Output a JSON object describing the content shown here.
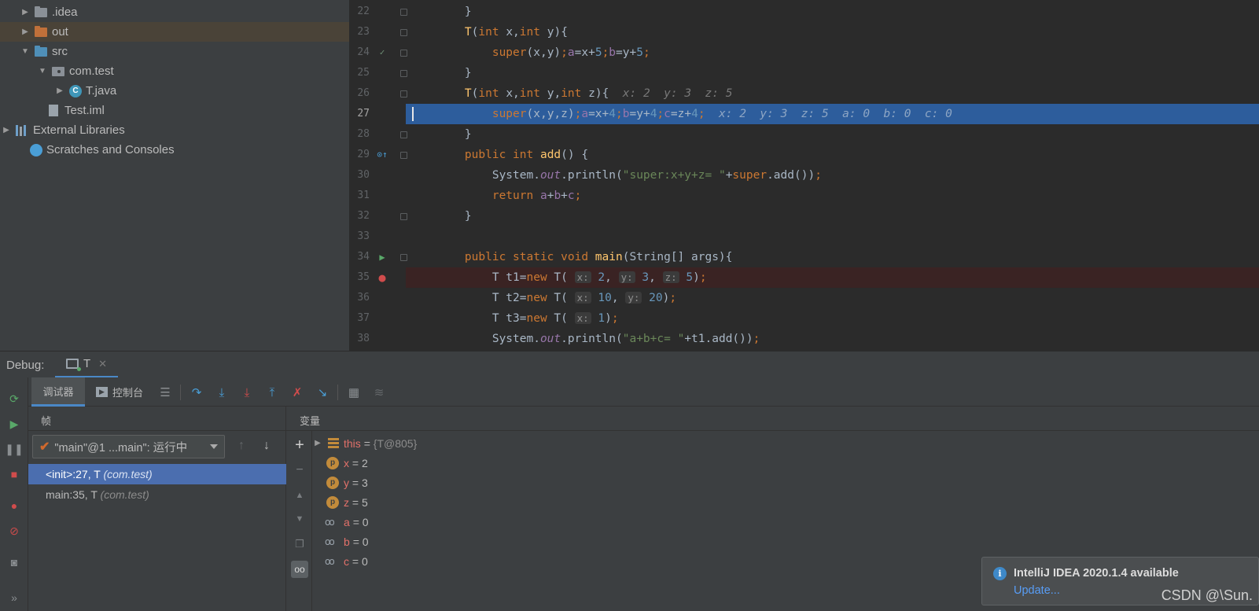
{
  "project_tree": {
    "items": [
      {
        "label": ".idea",
        "icon": "folder-icon",
        "expanded": false,
        "has_children": true
      },
      {
        "label": "out",
        "icon": "folder-icon",
        "expanded": false,
        "has_children": true,
        "selected": true
      },
      {
        "label": "src",
        "icon": "folder-icon",
        "expanded": true,
        "has_children": true
      },
      {
        "label": "com.test",
        "icon": "package-icon",
        "expanded": true,
        "has_children": true
      },
      {
        "label": "T.java",
        "icon": "java-class-icon",
        "expanded": false,
        "has_children": true
      },
      {
        "label": "Test.iml",
        "icon": "module-file-icon",
        "has_children": false
      },
      {
        "label": "External Libraries",
        "icon": "library-icon",
        "expanded": false,
        "has_children": true
      },
      {
        "label": "Scratches and Consoles",
        "icon": "scratch-icon",
        "has_children": false
      }
    ]
  },
  "editor": {
    "current_line": 27,
    "breakpoint_line": 35,
    "line_numbers": [
      "22",
      "23",
      "24",
      "25",
      "26",
      "27",
      "28",
      "29",
      "30",
      "31",
      "32",
      "33",
      "34",
      "35",
      "36",
      "37",
      "38"
    ],
    "lines": {
      "l22": "}",
      "l23_kw": "int",
      "l23_kw2": "int",
      "l26_hint": "x: 2  y: 3  z: 5",
      "l27_hint": "x: 2  y: 3  z: 5  a: 0  b: 0  c: 0",
      "l30_str": "\"super:x+y+z= \"",
      "l38_str": "\"a+b+c= \""
    }
  },
  "debug": {
    "title": "Debug:",
    "tab_label": "T",
    "tabs": {
      "debugger": "调试器",
      "console": "控制台"
    },
    "frames_header": "帧",
    "variables_header": "变量",
    "thread": "\"main\"@1 ...main\": 运行中",
    "frames": [
      {
        "method": "<init>:27, T",
        "package": "(com.test)"
      },
      {
        "method": "main:35, T",
        "package": "(com.test)"
      }
    ],
    "variables": [
      {
        "name": "this",
        "value": "{T@805}",
        "kind": "object"
      },
      {
        "name": "x",
        "value": "2",
        "kind": "param"
      },
      {
        "name": "y",
        "value": "3",
        "kind": "param"
      },
      {
        "name": "z",
        "value": "5",
        "kind": "param"
      },
      {
        "name": "a",
        "value": "0",
        "kind": "field"
      },
      {
        "name": "b",
        "value": "0",
        "kind": "field"
      },
      {
        "name": "c",
        "value": "0",
        "kind": "field"
      }
    ]
  },
  "notification": {
    "title": "IntelliJ IDEA 2020.1.4 available",
    "link": "Update..."
  },
  "watermark": "CSDN @\\Sun.",
  "colors": {
    "selection": "#4b6eaf",
    "current_line": "#2d5d9c",
    "keyword": "#cc7832",
    "string": "#6a8759",
    "number": "#6897bb"
  }
}
